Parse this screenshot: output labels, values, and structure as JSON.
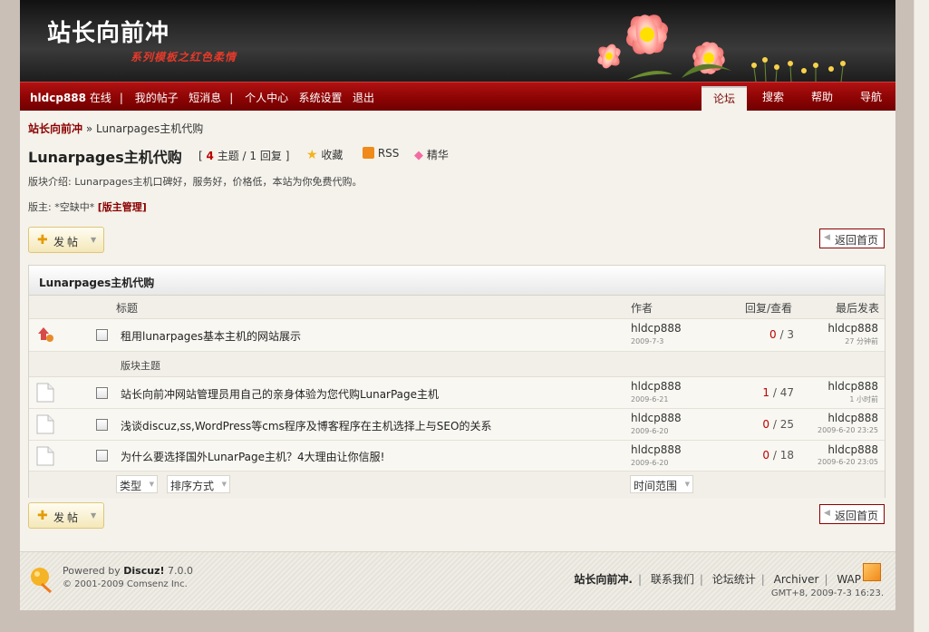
{
  "header": {
    "site_title": "站长向前冲",
    "subtitle": "系列模板之红色柔情"
  },
  "navbar": {
    "username": "hldcp888",
    "online": "在线",
    "links": [
      "我的帖子",
      "短消息",
      "个人中心",
      "系统设置",
      "退出"
    ],
    "tabs": [
      "论坛",
      "搜索",
      "帮助",
      "导航"
    ],
    "active_tab": "论坛"
  },
  "breadcrumb": {
    "home": "站长向前冲",
    "sep": "»",
    "current": "Lunarpages主机代购"
  },
  "forum": {
    "title": "Lunarpages主机代购",
    "stats_open": "[",
    "topics_count": "4",
    "topics_label": "主题",
    "stats_sep": "/",
    "replies_count": "1",
    "replies_label": "回复",
    "stats_close": "]",
    "favorite_label": "收藏",
    "rss_label": "RSS",
    "digest_label": "精华",
    "description": "版块介绍: Lunarpages主机口碑好，服务好，价格低，本站为你免费代购。",
    "moderators_label": "版主: *空缺中*",
    "mod_manage": "[版主管理]"
  },
  "buttons": {
    "post": "发帖",
    "back_home": "返回首页"
  },
  "table": {
    "section_title": "Lunarpages主机代购",
    "columns": {
      "title": "标题",
      "author": "作者",
      "replies_views": "回复/查看",
      "last_post": "最后发表"
    },
    "sticky": {
      "title": "租用lunarpages基本主机的网站展示",
      "author": "hldcp888",
      "date": "2009-7-3",
      "replies": "0",
      "views": "3",
      "last_author": "hldcp888",
      "last_time": "27 分钟前"
    },
    "section_topics_label": "版块主题",
    "rows": [
      {
        "title": "站长向前冲网站管理员用自己的亲身体验为您代购LunarPage主机",
        "author": "hldcp888",
        "date": "2009-6-21",
        "replies": "1",
        "views": "47",
        "last_author": "hldcp888",
        "last_time": "1 小时前"
      },
      {
        "title": "浅谈discuz,ss,WordPress等cms程序及博客程序在主机选择上与SEO的关系",
        "author": "hldcp888",
        "date": "2009-6-20",
        "replies": "0",
        "views": "25",
        "last_author": "hldcp888",
        "last_time": "2009-6-20 23:25"
      },
      {
        "title": "为什么要选择国外LunarPage主机？4大理由让你信服!",
        "author": "hldcp888",
        "date": "2009-6-20",
        "replies": "0",
        "views": "18",
        "last_author": "hldcp888",
        "last_time": "2009-6-20 23:05"
      }
    ],
    "filters": {
      "type": "类型",
      "sort": "排序方式",
      "time": "时间范围"
    }
  },
  "footer": {
    "powered_prefix": "Powered by",
    "brand": "Discuz!",
    "version": "7.0.0",
    "copyright": "© 2001-2009 Comsenz Inc.",
    "site_name": "站长向前冲.",
    "links": [
      "联系我们",
      "论坛统计",
      "Archiver",
      "WAP"
    ],
    "time": "GMT+8, 2009-7-3 16:23."
  }
}
